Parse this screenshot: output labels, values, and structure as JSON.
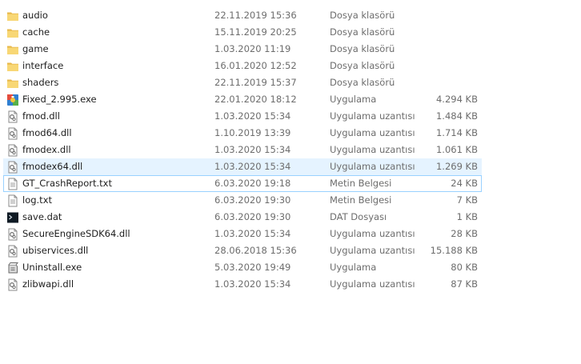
{
  "files": [
    {
      "name": "audio",
      "date": "22.11.2019 15:36",
      "type": "Dosya klasörü",
      "size": "",
      "icon": "folder-icon"
    },
    {
      "name": "cache",
      "date": "15.11.2019 20:25",
      "type": "Dosya klasörü",
      "size": "",
      "icon": "folder-icon"
    },
    {
      "name": "game",
      "date": "1.03.2020 11:19",
      "type": "Dosya klasörü",
      "size": "",
      "icon": "folder-icon"
    },
    {
      "name": "interface",
      "date": "16.01.2020 12:52",
      "type": "Dosya klasörü",
      "size": "",
      "icon": "folder-icon"
    },
    {
      "name": "shaders",
      "date": "22.11.2019 15:37",
      "type": "Dosya klasörü",
      "size": "",
      "icon": "folder-icon"
    },
    {
      "name": "Fixed_2.995.exe",
      "date": "22.01.2020 18:12",
      "type": "Uygulama",
      "size": "4.294 KB",
      "icon": "app-colorful-icon"
    },
    {
      "name": "fmod.dll",
      "date": "1.03.2020 15:34",
      "type": "Uygulama uzantısı",
      "size": "1.484 KB",
      "icon": "dll-icon"
    },
    {
      "name": "fmod64.dll",
      "date": "1.10.2019 13:39",
      "type": "Uygulama uzantısı",
      "size": "1.714 KB",
      "icon": "dll-icon"
    },
    {
      "name": "fmodex.dll",
      "date": "1.03.2020 15:34",
      "type": "Uygulama uzantısı",
      "size": "1.061 KB",
      "icon": "dll-icon"
    },
    {
      "name": "fmodex64.dll",
      "date": "1.03.2020 15:34",
      "type": "Uygulama uzantısı",
      "size": "1.269 KB",
      "icon": "dll-icon",
      "state": "hover"
    },
    {
      "name": "GT_CrashReport.txt",
      "date": "6.03.2020 19:18",
      "type": "Metin Belgesi",
      "size": "24 KB",
      "icon": "text-file-icon",
      "state": "focused"
    },
    {
      "name": "log.txt",
      "date": "6.03.2020 19:30",
      "type": "Metin Belgesi",
      "size": "7 KB",
      "icon": "text-file-icon"
    },
    {
      "name": "save.dat",
      "date": "6.03.2020 19:30",
      "type": "DAT Dosyası",
      "size": "1 KB",
      "icon": "dat-file-icon"
    },
    {
      "name": "SecureEngineSDK64.dll",
      "date": "1.03.2020 15:34",
      "type": "Uygulama uzantısı",
      "size": "28 KB",
      "icon": "dll-icon"
    },
    {
      "name": "ubiservices.dll",
      "date": "28.06.2018 15:36",
      "type": "Uygulama uzantısı",
      "size": "15.188 KB",
      "icon": "dll-icon"
    },
    {
      "name": "Uninstall.exe",
      "date": "5.03.2020 19:49",
      "type": "Uygulama",
      "size": "80 KB",
      "icon": "uninstall-icon"
    },
    {
      "name": "zlibwapi.dll",
      "date": "1.03.2020 15:34",
      "type": "Uygulama uzantısı",
      "size": "87 KB",
      "icon": "dll-icon"
    }
  ],
  "colors": {
    "hover_bg": "#e5f3ff",
    "focus_border": "#99d1ff",
    "folder": "#f8d775",
    "secondary_text": "#6d6d6d"
  }
}
